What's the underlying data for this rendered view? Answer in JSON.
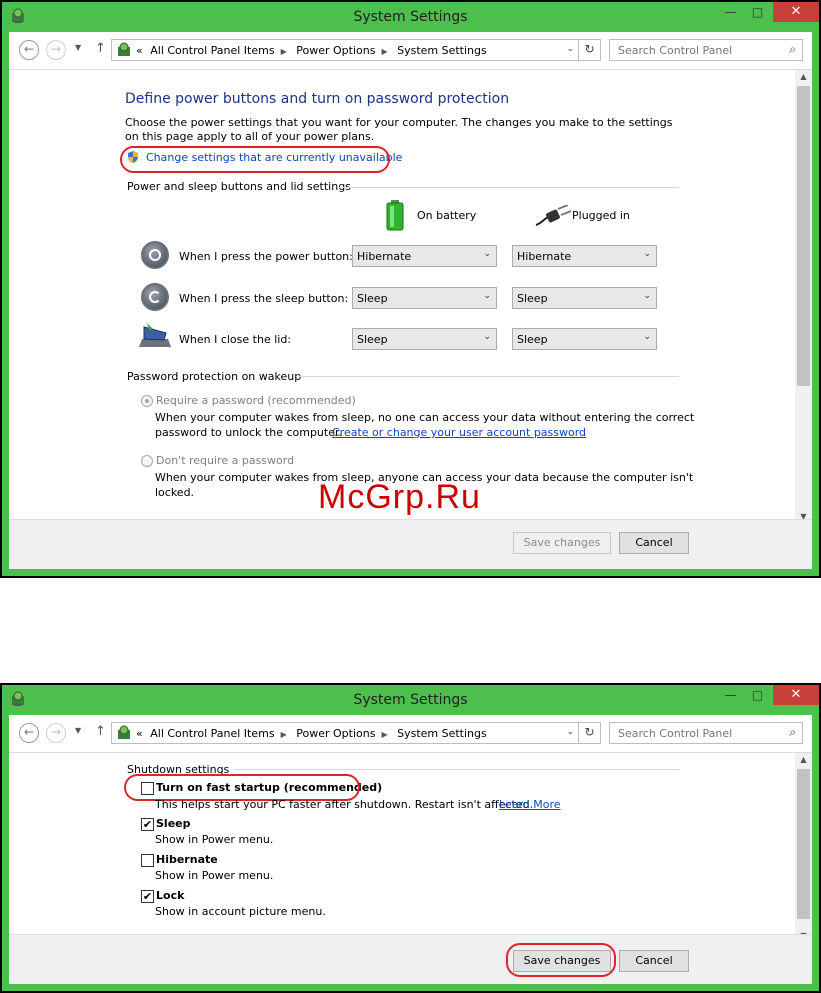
{
  "window_top": {
    "title": "System Settings",
    "controls": {
      "minimize": "—",
      "maximize": "□",
      "close": "✕"
    },
    "breadcrumb": [
      "All Control Panel Items",
      "Power Options",
      "System Settings"
    ],
    "breadcrumb_prefix": "«",
    "search_placeholder": "Search Control Panel",
    "heading": "Define power buttons and turn on password protection",
    "description": "Choose the power settings that you want for your computer. The changes you make to the settings on this page apply to all of your power plans.",
    "change_settings_link": "Change settings that are currently unavailable",
    "section_power": "Power and sleep buttons and lid settings",
    "col_battery": "On battery",
    "col_plugged": "Plugged in",
    "rows": [
      {
        "label": "When I press the power button:",
        "battery": "Hibernate",
        "plugged": "Hibernate"
      },
      {
        "label": "When I press the sleep button:",
        "battery": "Sleep",
        "plugged": "Sleep"
      },
      {
        "label": "When I close the lid:",
        "battery": "Sleep",
        "plugged": "Sleep"
      }
    ],
    "section_password": "Password protection on wakeup",
    "require_password": {
      "label": "Require a password (recommended)",
      "desc_line1": "When your computer wakes from sleep, no one can access your data without entering the correct",
      "desc_line2": "password to unlock the computer.",
      "link": "Create or change your user account password"
    },
    "no_password": {
      "label": "Don't require a password",
      "desc_line1": "When your computer wakes from sleep, anyone can access your data because the computer isn't",
      "desc_line2": "locked."
    },
    "save_label": "Save changes",
    "cancel_label": "Cancel"
  },
  "window_bottom": {
    "title": "System Settings",
    "controls": {
      "minimize": "—",
      "maximize": "□",
      "close": "✕"
    },
    "breadcrumb": [
      "All Control Panel Items",
      "Power Options",
      "System Settings"
    ],
    "breadcrumb_prefix": "«",
    "search_placeholder": "Search Control Panel",
    "section_shutdown": "Shutdown settings",
    "options": [
      {
        "label": "Turn on fast startup (recommended)",
        "desc": "This helps start your PC faster after shutdown. Restart isn't affected.",
        "link": "Learn More",
        "checked": false
      },
      {
        "label": "Sleep",
        "desc": "Show in Power menu.",
        "checked": true
      },
      {
        "label": "Hibernate",
        "desc": "Show in Power menu.",
        "checked": false
      },
      {
        "label": "Lock",
        "desc": "Show in account picture menu.",
        "checked": true
      }
    ],
    "save_label": "Save changes",
    "cancel_label": "Cancel"
  },
  "watermark": "McGrp.Ru",
  "colors": {
    "frame": "#4cbf4c",
    "highlight_oval": "#d8262a",
    "heading": "#1e3287",
    "link": "#0a49b5",
    "close_button": "#c7403a"
  }
}
